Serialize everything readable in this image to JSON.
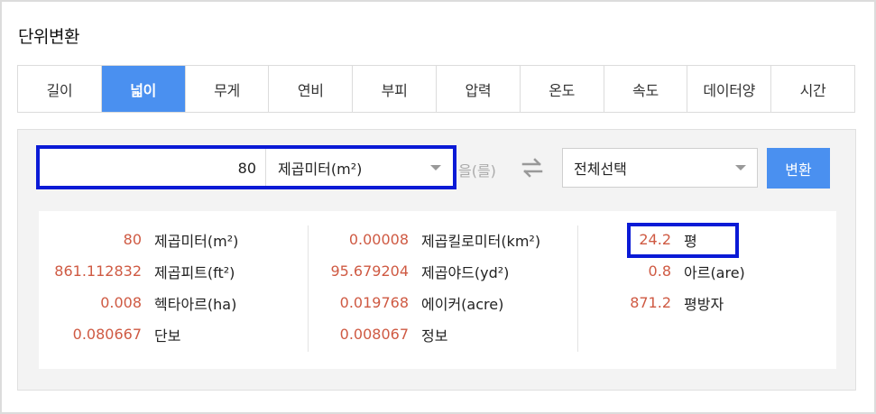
{
  "page_title": "단위변환",
  "tabs": [
    {
      "label": "길이",
      "active": false
    },
    {
      "label": "넓이",
      "active": true
    },
    {
      "label": "무게",
      "active": false
    },
    {
      "label": "연비",
      "active": false
    },
    {
      "label": "부피",
      "active": false
    },
    {
      "label": "압력",
      "active": false
    },
    {
      "label": "온도",
      "active": false
    },
    {
      "label": "속도",
      "active": false
    },
    {
      "label": "데이터양",
      "active": false
    },
    {
      "label": "시간",
      "active": false
    }
  ],
  "converter": {
    "input_value": "80",
    "source_unit": "제곱미터(m²)",
    "particle": "을(를)",
    "target_unit": "전체선택",
    "convert_label": "변환"
  },
  "results": {
    "col1": [
      {
        "value": "80",
        "unit": "제곱미터(m²)"
      },
      {
        "value": "861.112832",
        "unit": "제곱피트(ft²)"
      },
      {
        "value": "0.008",
        "unit": "헥타아르(ha)"
      },
      {
        "value": "0.080667",
        "unit": "단보"
      }
    ],
    "col2": [
      {
        "value": "0.00008",
        "unit": "제곱킬로미터(km²)"
      },
      {
        "value": "95.679204",
        "unit": "제곱야드(yd²)"
      },
      {
        "value": "0.019768",
        "unit": "에이커(acre)"
      },
      {
        "value": "0.008067",
        "unit": "정보"
      }
    ],
    "col3": [
      {
        "value": "24.2",
        "unit": "평"
      },
      {
        "value": "0.8",
        "unit": "아르(are)"
      },
      {
        "value": "871.2",
        "unit": "평방자"
      }
    ]
  },
  "colors": {
    "accent": "#4a90f0",
    "value_text": "#cf5a43",
    "highlight_box": "#0a1ad6"
  },
  "icons": {
    "swap": "swap-arrows-icon",
    "dropdown": "chevron-down-icon"
  }
}
